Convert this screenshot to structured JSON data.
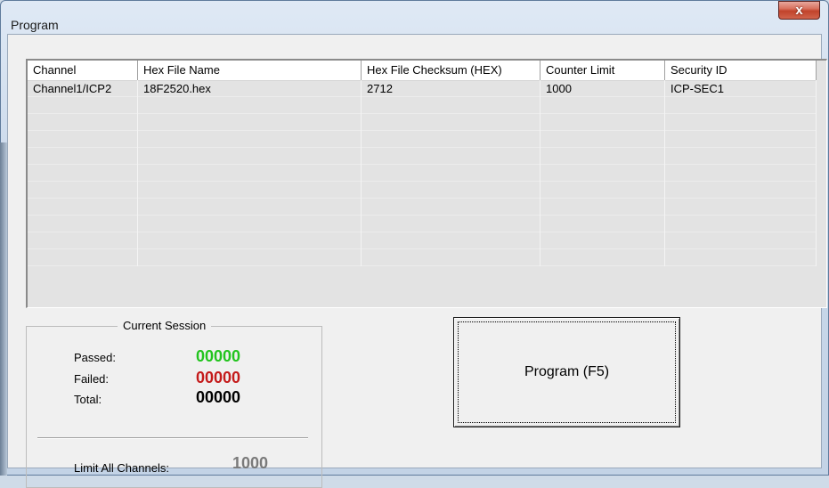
{
  "window": {
    "title": "Program",
    "close_glyph": "x"
  },
  "table": {
    "headers": [
      "Channel",
      "Hex File Name",
      "Hex File Checksum (HEX)",
      "Counter Limit",
      "Security ID"
    ],
    "rows": [
      [
        "Channel1/ICP2",
        "18F2520.hex",
        "2712",
        "1000",
        "ICP-SEC1"
      ]
    ],
    "empty_rows": 10
  },
  "session": {
    "legend": "Current Session",
    "passed_label": "Passed:",
    "passed_value": "00000",
    "failed_label": "Failed:",
    "failed_value": "00000",
    "total_label": "Total:",
    "total_value": "00000",
    "limit_label": "Limit All Channels:",
    "limit_value": "1000"
  },
  "program_button": {
    "label": "Program (F5)"
  },
  "colors": {
    "passed": "#22c41e",
    "failed": "#c41a1a",
    "total": "#000000",
    "limit": "#7a7a7a"
  }
}
